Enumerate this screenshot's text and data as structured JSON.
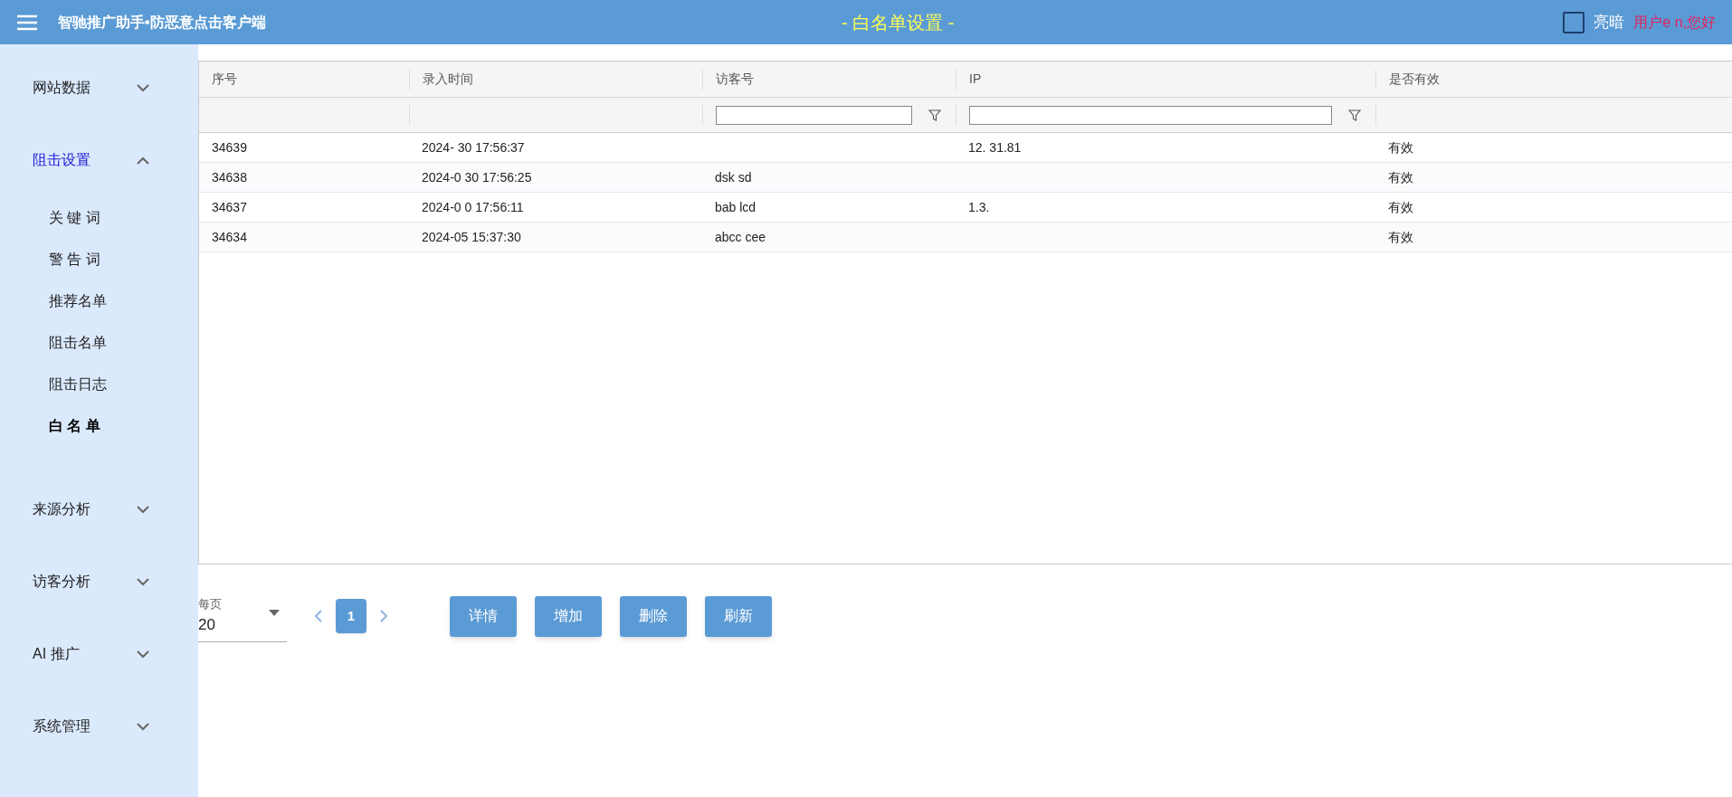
{
  "header": {
    "app_title": "智驰推广助手•防恶意点击客户端",
    "page_title": "- 白名单设置 -",
    "theme_toggle": {
      "label": "亮暗",
      "checked": false
    },
    "greeting": "用户e n,您好"
  },
  "sidebar": {
    "groups": [
      {
        "label": "网站数据",
        "expanded": false
      },
      {
        "label": "阻击设置",
        "expanded": true,
        "items": [
          {
            "label": "关 键 词",
            "selected": false
          },
          {
            "label": "警 告 词",
            "selected": false
          },
          {
            "label": "推荐名单",
            "selected": false
          },
          {
            "label": "阻击名单",
            "selected": false
          },
          {
            "label": "阻击日志",
            "selected": false
          },
          {
            "label": "白 名 单",
            "selected": true
          }
        ]
      },
      {
        "label": "来源分析",
        "expanded": false
      },
      {
        "label": "访客分析",
        "expanded": false
      },
      {
        "label": "AI 推广",
        "expanded": false
      },
      {
        "label": "系统管理",
        "expanded": false
      }
    ]
  },
  "table": {
    "columns": [
      {
        "label": "序号",
        "filter": false
      },
      {
        "label": "录入时间",
        "filter": false
      },
      {
        "label": "访客号",
        "filter": true
      },
      {
        "label": "IP",
        "filter": true
      },
      {
        "label": "是否有效",
        "filter": false
      }
    ],
    "rows": [
      [
        "34639",
        "2024- 30 17:56:37",
        "",
        "12. 31.81",
        "有效"
      ],
      [
        "34638",
        "2024-0 30 17:56:25",
        "dsk sd",
        "",
        "有效"
      ],
      [
        "34637",
        "2024-0 0 17:56:11",
        "bab lcd",
        "1.3.",
        "有效"
      ],
      [
        "34634",
        "2024-05 15:37:30",
        "abcc cee",
        "",
        "有效"
      ]
    ]
  },
  "pagination": {
    "per_page_label": "每页",
    "per_page_value": "20",
    "pages": [
      {
        "label": "1",
        "selected": true
      }
    ]
  },
  "buttons": [
    "详情",
    "增加",
    "删除",
    "刷新"
  ]
}
